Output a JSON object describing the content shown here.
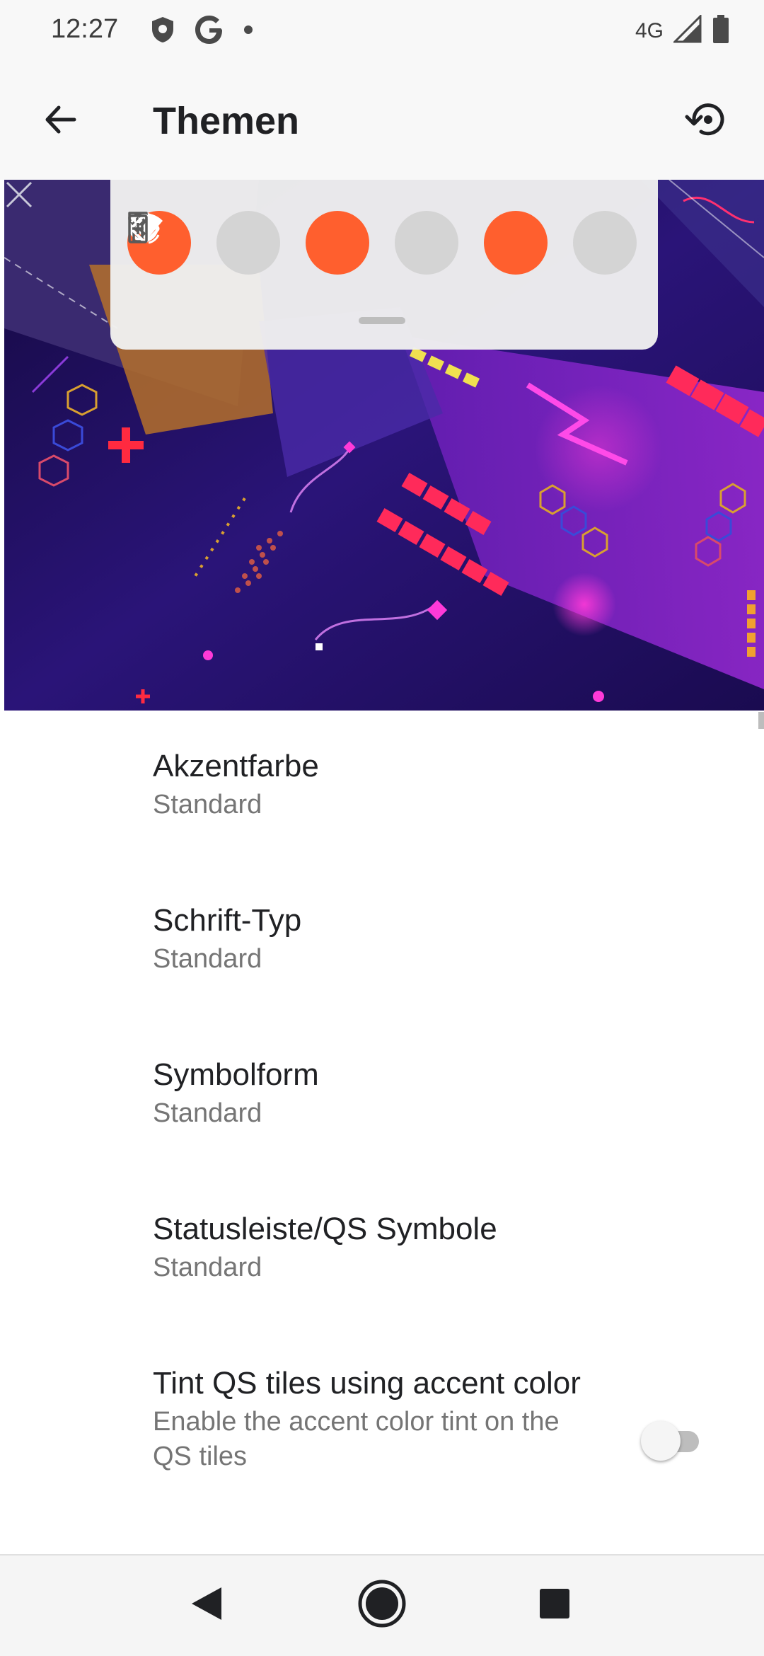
{
  "status_bar": {
    "time": "12:27",
    "network": "4G",
    "icons": [
      "shield-icon",
      "google-icon",
      "notification-dot-icon",
      "signal-icon",
      "battery-icon"
    ]
  },
  "app_bar": {
    "title": "Themen",
    "back_icon": "arrow-back-icon",
    "reset_icon": "restore-icon"
  },
  "preview": {
    "quick_tiles": [
      {
        "icon": "wifi-icon",
        "state": "on"
      },
      {
        "icon": "bluetooth-icon",
        "state": "off"
      },
      {
        "icon": "do-not-disturb-icon",
        "state": "on"
      },
      {
        "icon": "flashlight-icon",
        "state": "off"
      },
      {
        "icon": "auto-rotate-icon",
        "state": "on"
      },
      {
        "icon": "battery-saver-icon",
        "state": "off"
      }
    ]
  },
  "settings": [
    {
      "title": "Akzentfarbe",
      "summary": "Standard"
    },
    {
      "title": "Schrift-Typ",
      "summary": "Standard"
    },
    {
      "title": "Symbolform",
      "summary": "Standard"
    },
    {
      "title": "Statusleiste/QS Symbole",
      "summary": "Standard"
    },
    {
      "title": "Tint QS tiles using accent color",
      "summary": "Enable the accent color tint on the QS tiles",
      "toggle_on": false
    }
  ],
  "colors": {
    "accent": "#ff5f2e",
    "tile_off": "#d4d4d4",
    "wallpaper_base": "#1b0f5e"
  },
  "nav_bar": {
    "icons": [
      "back-triangle-icon",
      "home-circle-icon",
      "recents-square-icon"
    ]
  }
}
